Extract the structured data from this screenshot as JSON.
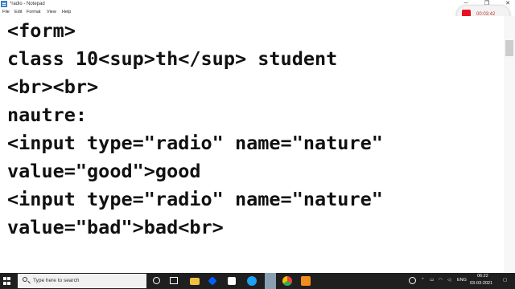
{
  "window": {
    "title": "*radio - Notepad",
    "controls": {
      "minimize": "─",
      "maximize": "❐",
      "close": "✕"
    }
  },
  "menu": [
    "File",
    "Edit",
    "Format",
    "View",
    "Help"
  ],
  "recorder": {
    "time": "00:03:42",
    "stop_color": "#e81123"
  },
  "editor": {
    "lines": [
      "<form>",
      "class 10<sup>th</sup> student",
      "<br><br>",
      "nautre:",
      "<input type=\"radio\" name=\"nature\"",
      "value=\"good\">good",
      "<input type=\"radio\" name=\"nature\"",
      "value=\"bad\">bad<br>"
    ]
  },
  "taskbar": {
    "search_placeholder": "Type here to search",
    "apps": [
      {
        "name": "cortana-icon",
        "color": "#ffffff"
      },
      {
        "name": "task-view-icon",
        "color": "#ffffff"
      },
      {
        "name": "file-explorer-icon",
        "color": "#f0c040"
      },
      {
        "name": "dropbox-icon",
        "color": "#0061fe"
      },
      {
        "name": "store-icon",
        "color": "#ffffff"
      },
      {
        "name": "edge-icon",
        "color": "#1da1f2"
      },
      {
        "name": "notepad-icon",
        "color": "#9fb6cd"
      },
      {
        "name": "chrome-icon",
        "color": "#fbbc05"
      },
      {
        "name": "app-orange-icon",
        "color": "#f28c1e"
      }
    ],
    "tray": {
      "language": "ENG",
      "time": "06:22",
      "date": "03-03-2021"
    }
  }
}
